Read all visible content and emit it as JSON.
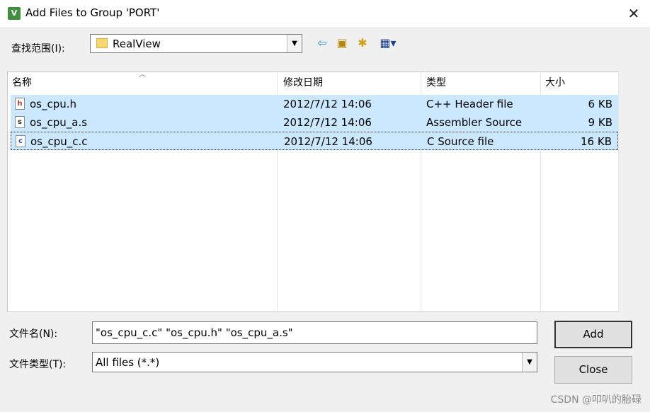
{
  "window": {
    "title": "Add Files to Group 'PORT'",
    "app_icon_text": "V"
  },
  "look_in": {
    "label": "查找范围(I):",
    "value": "RealView"
  },
  "toolbar": {
    "back_icon": "back-arrow-icon",
    "up_icon": "up-folder-icon",
    "new_folder_icon": "new-folder-icon",
    "view_icon": "view-menu-icon"
  },
  "file_list": {
    "columns": [
      "名称",
      "修改日期",
      "类型",
      "大小"
    ],
    "rows": [
      {
        "name": "os_cpu.h",
        "icon": "h",
        "date": "2012/7/12 14:06",
        "type": "C++ Header file",
        "size": "6 KB"
      },
      {
        "name": "os_cpu_a.s",
        "icon": "s",
        "date": "2012/7/12 14:06",
        "type": "Assembler Source",
        "size": "9 KB"
      },
      {
        "name": "os_cpu_c.c",
        "icon": "c",
        "date": "2012/7/12 14:06",
        "type": "C Source file",
        "size": "16 KB"
      }
    ]
  },
  "file_name": {
    "label": "文件名(N):",
    "value": "\"os_cpu_c.c\" \"os_cpu.h\" \"os_cpu_a.s\""
  },
  "file_type": {
    "label": "文件类型(T):",
    "value": "All files (*.*)"
  },
  "buttons": {
    "add": "Add",
    "close": "Close"
  },
  "watermark": "CSDN @叩叭的胎碌"
}
